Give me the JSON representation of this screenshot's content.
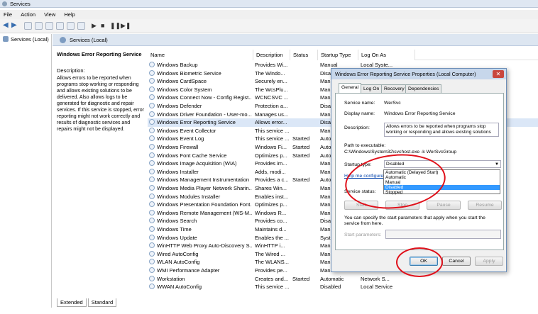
{
  "window": {
    "title": "Services"
  },
  "menu": [
    "File",
    "Action",
    "View",
    "Help"
  ],
  "tree": {
    "root": "Services (Local)"
  },
  "header": {
    "title": "Services (Local)"
  },
  "details": {
    "service_title": "Windows Error Reporting Service",
    "description_label": "Description:",
    "description": "Allows errors to be reported when programs stop working or responding and allows existing solutions to be delivered. Also allows logs to be generated for diagnostic and repair services. If this service is stopped, error reporting might not work correctly and results of diagnostic services and repairs might not be displayed."
  },
  "columns": [
    "Name",
    "Description",
    "Status",
    "Startup Type",
    "Log On As"
  ],
  "services": [
    {
      "name": "Windows Backup",
      "desc": "Provides Wi...",
      "status": "",
      "startup": "Manual",
      "logon": "Local Syste..."
    },
    {
      "name": "Windows Biometric Service",
      "desc": "The Windo...",
      "status": "",
      "startup": "Disal",
      "logon": ""
    },
    {
      "name": "Windows CardSpace",
      "desc": "Securely en...",
      "status": "",
      "startup": "Manu",
      "logon": ""
    },
    {
      "name": "Windows Color System",
      "desc": "The WcsPlu...",
      "status": "",
      "startup": "Manu",
      "logon": ""
    },
    {
      "name": "Windows Connect Now - Config Regist...",
      "desc": "WCNCSVC ...",
      "status": "",
      "startup": "Manu",
      "logon": ""
    },
    {
      "name": "Windows Defender",
      "desc": "Protection a...",
      "status": "",
      "startup": "Disal",
      "logon": ""
    },
    {
      "name": "Windows Driver Foundation - User-mo...",
      "desc": "Manages us...",
      "status": "",
      "startup": "Manu",
      "logon": ""
    },
    {
      "name": "Windows Error Reporting Service",
      "desc": "Allows error...",
      "status": "",
      "startup": "Disal",
      "logon": ""
    },
    {
      "name": "Windows Event Collector",
      "desc": "This service ...",
      "status": "",
      "startup": "Manu",
      "logon": ""
    },
    {
      "name": "Windows Event Log",
      "desc": "This service ...",
      "status": "Started",
      "startup": "Auto",
      "logon": ""
    },
    {
      "name": "Windows Firewall",
      "desc": "Windows Fi...",
      "status": "Started",
      "startup": "Auto",
      "logon": ""
    },
    {
      "name": "Windows Font Cache Service",
      "desc": "Optimizes p...",
      "status": "Started",
      "startup": "Auto",
      "logon": ""
    },
    {
      "name": "Windows Image Acquisition (WIA)",
      "desc": "Provides im...",
      "status": "",
      "startup": "Manu",
      "logon": ""
    },
    {
      "name": "Windows Installer",
      "desc": "Adds, modi...",
      "status": "",
      "startup": "Manu",
      "logon": ""
    },
    {
      "name": "Windows Management Instrumentation",
      "desc": "Provides a c...",
      "status": "Started",
      "startup": "Auto",
      "logon": ""
    },
    {
      "name": "Windows Media Player Network Sharin...",
      "desc": "Shares Win...",
      "status": "",
      "startup": "Manu",
      "logon": ""
    },
    {
      "name": "Windows Modules Installer",
      "desc": "Enables inst...",
      "status": "",
      "startup": "Manu",
      "logon": ""
    },
    {
      "name": "Windows Presentation Foundation Font...",
      "desc": "Optimizes p...",
      "status": "",
      "startup": "Manu",
      "logon": ""
    },
    {
      "name": "Windows Remote Management (WS-M...",
      "desc": "Windows R...",
      "status": "",
      "startup": "Manu",
      "logon": ""
    },
    {
      "name": "Windows Search",
      "desc": "Provides co...",
      "status": "",
      "startup": "Disal",
      "logon": ""
    },
    {
      "name": "Windows Time",
      "desc": "Maintains d...",
      "status": "",
      "startup": "Manu",
      "logon": ""
    },
    {
      "name": "Windows Update",
      "desc": "Enables the ...",
      "status": "",
      "startup": "Syste",
      "logon": ""
    },
    {
      "name": "WinHTTP Web Proxy Auto-Discovery S...",
      "desc": "WinHTTP i...",
      "status": "",
      "startup": "Manu",
      "logon": ""
    },
    {
      "name": "Wired AutoConfig",
      "desc": "The Wired ...",
      "status": "",
      "startup": "Manu",
      "logon": ""
    },
    {
      "name": "WLAN AutoConfig",
      "desc": "The WLANS...",
      "status": "",
      "startup": "Manu",
      "logon": ""
    },
    {
      "name": "WMI Performance Adapter",
      "desc": "Provides pe...",
      "status": "",
      "startup": "Manu",
      "logon": ""
    },
    {
      "name": "Workstation",
      "desc": "Creates and...",
      "status": "Started",
      "startup": "Automatic",
      "logon": "Network S..."
    },
    {
      "name": "WWAN AutoConfig",
      "desc": "This service ...",
      "status": "",
      "startup": "Disabled",
      "logon": "Local Service"
    }
  ],
  "view_tabs": [
    "Extended",
    "Standard"
  ],
  "dialog": {
    "title": "Windows Error Reporting Service Properties (Local Computer)",
    "tabs": [
      "General",
      "Log On",
      "Recovery",
      "Dependencies"
    ],
    "service_name_label": "Service name:",
    "service_name": "WerSvc",
    "display_name_label": "Display name:",
    "display_name": "Windows Error Reporting Service",
    "description_label": "Description:",
    "description": "Allows errors to be reported when programs stop working or responding and allows existing solutions",
    "path_label": "Path to executable:",
    "path": "C:\\Windows\\System32\\svchost.exe -k WerSvcGroup",
    "startup_type_label": "Startup type:",
    "startup_type": "Disabled",
    "help_link": "Help me configure",
    "startup_options": [
      "Automatic (Delayed Start)",
      "Automatic",
      "Manual",
      "Disabled"
    ],
    "status_label": "Service status:",
    "status_value": "Stopped",
    "buttons": {
      "start": "Start",
      "stop": "Stop",
      "pause": "Pause",
      "resume": "Resume"
    },
    "hint": "You can specify the start parameters that apply when you start the service from here.",
    "params_label": "Start parameters:",
    "ok": "OK",
    "cancel": "Cancel",
    "apply": "Apply"
  }
}
